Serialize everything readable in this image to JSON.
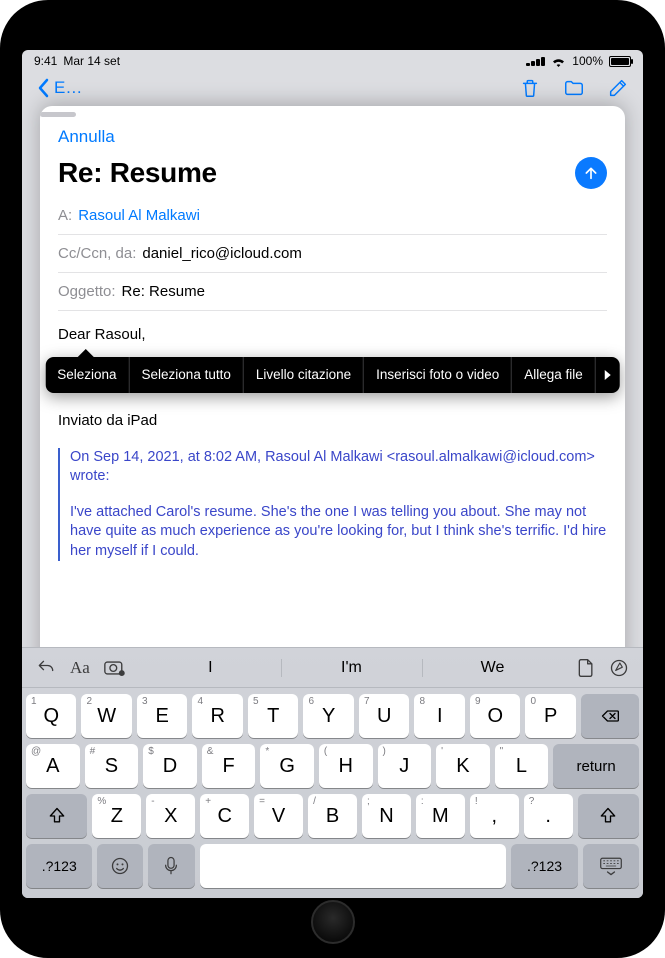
{
  "status": {
    "time": "9:41",
    "date": "Mar 14 set",
    "battery_pct": "100%"
  },
  "mail_background": {
    "back_label": "E…"
  },
  "compose": {
    "cancel": "Annulla",
    "title": "Re: Resume",
    "to_label": "A:",
    "to_value": "Rasoul Al Malkawi",
    "cc_label": "Cc/Ccn, da:",
    "cc_value": "daniel_rico@icloud.com",
    "subject_label": "Oggetto:",
    "subject_value": "Re: Resume",
    "greeting": "Dear Rasoul,",
    "signature": "Inviato da iPad",
    "quote_header": "On Sep 14, 2021, at 8:02 AM, Rasoul Al Malkawi <rasoul.almalkawi@icloud.com> wrote:",
    "quote_body": "I've attached Carol's resume. She's the one I was telling you about. She may not have quite as much experience as you're looking for, but I think she's terrific. I'd hire her myself if I could."
  },
  "edit_menu": {
    "select": "Seleziona",
    "select_all": "Seleziona tutto",
    "quote_level": "Livello citazione",
    "insert_media": "Inserisci foto o video",
    "attach": "Allega file"
  },
  "suggestions": [
    "I",
    "I'm",
    "We"
  ],
  "keys": {
    "row1": [
      {
        "alt": "1",
        "main": "Q"
      },
      {
        "alt": "2",
        "main": "W"
      },
      {
        "alt": "3",
        "main": "E"
      },
      {
        "alt": "4",
        "main": "R"
      },
      {
        "alt": "5",
        "main": "T"
      },
      {
        "alt": "6",
        "main": "Y"
      },
      {
        "alt": "7",
        "main": "U"
      },
      {
        "alt": "8",
        "main": "I"
      },
      {
        "alt": "9",
        "main": "O"
      },
      {
        "alt": "0",
        "main": "P"
      }
    ],
    "row2": [
      {
        "alt": "@",
        "main": "A"
      },
      {
        "alt": "#",
        "main": "S"
      },
      {
        "alt": "$",
        "main": "D"
      },
      {
        "alt": "&",
        "main": "F"
      },
      {
        "alt": "*",
        "main": "G"
      },
      {
        "alt": "(",
        "main": "H"
      },
      {
        "alt": ")",
        "main": "J"
      },
      {
        "alt": "'",
        "main": "K"
      },
      {
        "alt": "\"",
        "main": "L"
      }
    ],
    "row3": [
      {
        "alt": "%",
        "main": "Z"
      },
      {
        "alt": "-",
        "main": "X"
      },
      {
        "alt": "+",
        "main": "C"
      },
      {
        "alt": "=",
        "main": "V"
      },
      {
        "alt": "/",
        "main": "B"
      },
      {
        "alt": ";",
        "main": "N"
      },
      {
        "alt": ":",
        "main": "M"
      },
      {
        "alt": "!",
        "main": ","
      },
      {
        "alt": "?",
        "main": "."
      }
    ],
    "numbers_label": ".?123",
    "return_label": "return"
  }
}
